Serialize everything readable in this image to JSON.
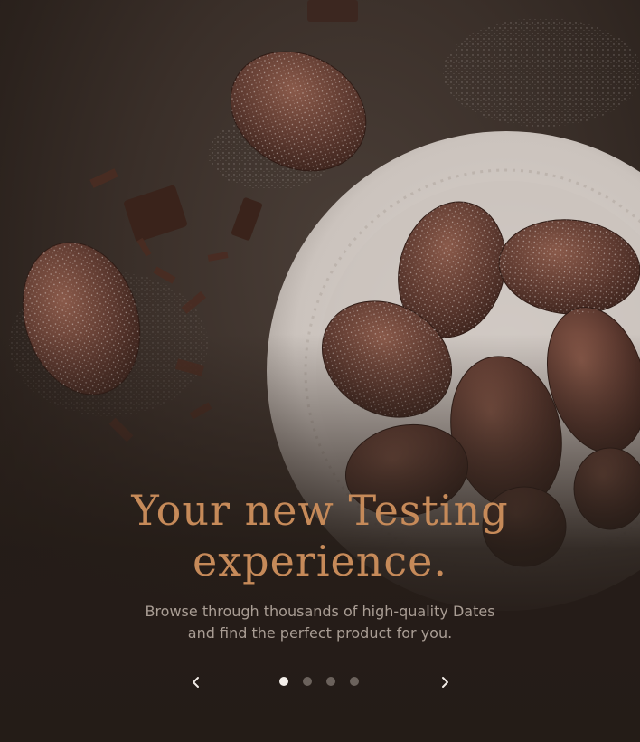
{
  "hero": {
    "image_icon": "madeleines-chocolate-photo",
    "title_line1": "Your new Testing",
    "title_line2": "experience.",
    "subtitle_line1": "Browse through thousands of high-quality Dates",
    "subtitle_line2": "and find the perfect product for you.",
    "accent_color": "#c68a59"
  },
  "carousel": {
    "prev_icon": "chevron-left-icon",
    "next_icon": "chevron-right-icon",
    "slide_count": 4,
    "active_index": 0
  }
}
